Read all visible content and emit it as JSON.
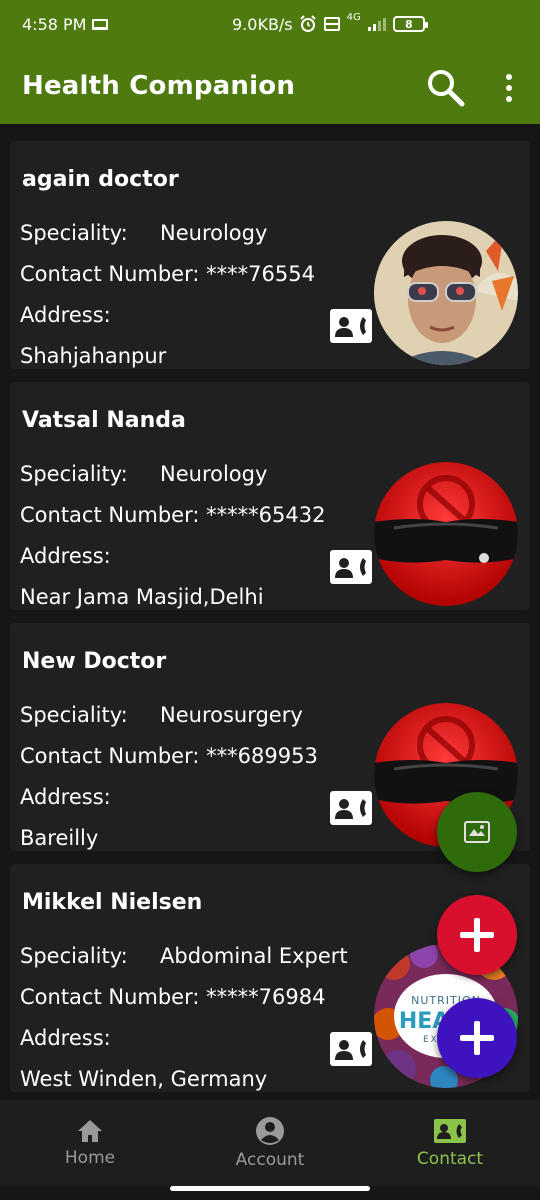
{
  "status_bar": {
    "time": "4:58 PM",
    "net_speed": "9.0KB/s",
    "network": "4G",
    "battery": "8"
  },
  "app_bar": {
    "title": "Health Companion"
  },
  "labels": {
    "speciality": "Speciality:",
    "contact_number": "Contact Number:",
    "address": "Address:"
  },
  "doctors": [
    {
      "name": "again doctor",
      "speciality": "Neurology",
      "contact": "****76554",
      "address": "Shahjahanpur",
      "avatar": "person-photo"
    },
    {
      "name": "Vatsal Nanda",
      "speciality": "Neurology",
      "contact": "*****65432",
      "address": "Near Jama Masjid,Delhi",
      "avatar": "no-entry-placeholder"
    },
    {
      "name": "New Doctor",
      "speciality": "Neurosurgery",
      "contact": "***689953",
      "address": "Bareilly",
      "avatar": "no-entry-placeholder"
    },
    {
      "name": "Mikkel Nielsen",
      "speciality": "Abdominal Expert",
      "contact": "*****76984",
      "address": "West Winden, Germany",
      "avatar": "nutrition-health-expert"
    }
  ],
  "avatar_text": {
    "line1": "NUTRITION",
    "line2": "HEALTH",
    "line3": "EXPERT"
  },
  "bottom_nav": [
    {
      "label": "Home",
      "icon": "home-icon",
      "active": false
    },
    {
      "label": "Account",
      "icon": "account-circle-icon",
      "active": false
    },
    {
      "label": "Contact",
      "icon": "contact-card-icon",
      "active": true
    }
  ],
  "colors": {
    "app_bar": "#4e7a0f",
    "background": "#161616",
    "card": "#202020",
    "fab_map": "#2e6b0b",
    "fab_red": "#d8102d",
    "fab_purple": "#3f12c0",
    "nav_active": "#8bc34a"
  }
}
